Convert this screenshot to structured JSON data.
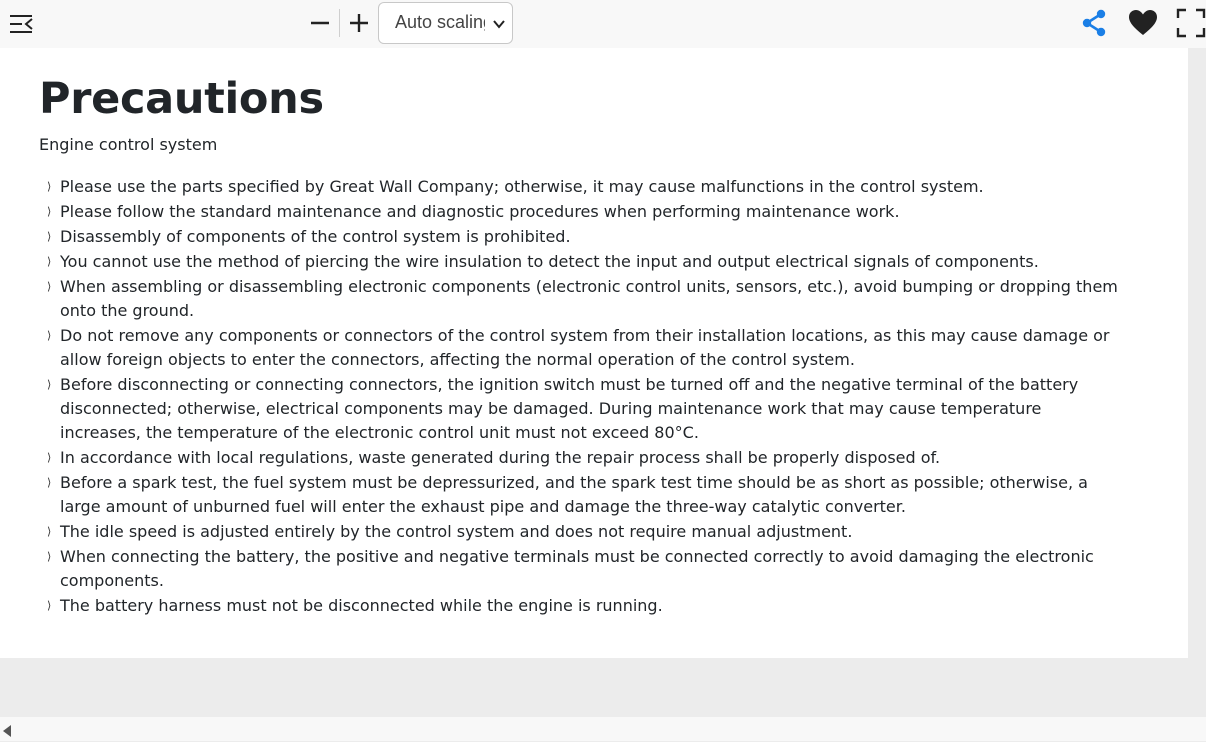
{
  "toolbar": {
    "icons": {
      "sidebar": "sidebar-toggle-icon",
      "zoom_out": "minus-icon",
      "zoom_in": "plus-icon",
      "dropdown": "chevron-down-icon",
      "share": "share-icon",
      "favorite": "heart-icon",
      "fullscreen": "fullscreen-icon"
    },
    "scale_value": "Auto scaling",
    "colors": {
      "share": "#1b7fe6",
      "icon": "#222222"
    }
  },
  "document": {
    "title": "Precautions",
    "subtitle": "Engine control system",
    "items": [
      "Please use the parts specified by Great Wall Company; otherwise, it may cause malfunctions in the control system.",
      "Please follow the standard maintenance and diagnostic procedures when performing maintenance work.",
      "Disassembly of components of the control system is prohibited.",
      "You cannot use the method of piercing the wire insulation to detect the input and output electrical signals of components.",
      "When assembling or disassembling electronic components (electronic control units, sensors, etc.), avoid bumping or dropping them onto the ground.",
      "Do not remove any components or connectors of the control system from their installation locations, as this may cause damage or allow foreign objects to enter the connectors, affecting the normal operation of the control system.",
      "Before disconnecting or connecting connectors, the ignition switch must be turned off and the negative terminal of the battery disconnected; otherwise, electrical components may be damaged. During maintenance work that may cause temperature increases, the temperature of the electronic control unit must not exceed 80°C.",
      "In accordance with local regulations, waste generated during the repair process shall be properly disposed of.",
      "Before a spark test, the fuel system must be depressurized, and the spark test time should be as short as possible; otherwise, a large amount of unburned fuel will enter the exhaust pipe and damage the three-way catalytic converter.",
      "The idle speed is adjusted entirely by the control system and does not require manual adjustment.",
      "When connecting the battery, the positive and negative terminals must be connected correctly to avoid damaging the electronic components.",
      "The battery harness must not be disconnected while the engine is running."
    ],
    "marker": "⟩"
  },
  "scrollbar": {
    "left_icon": "scroll-left-arrow-icon"
  }
}
